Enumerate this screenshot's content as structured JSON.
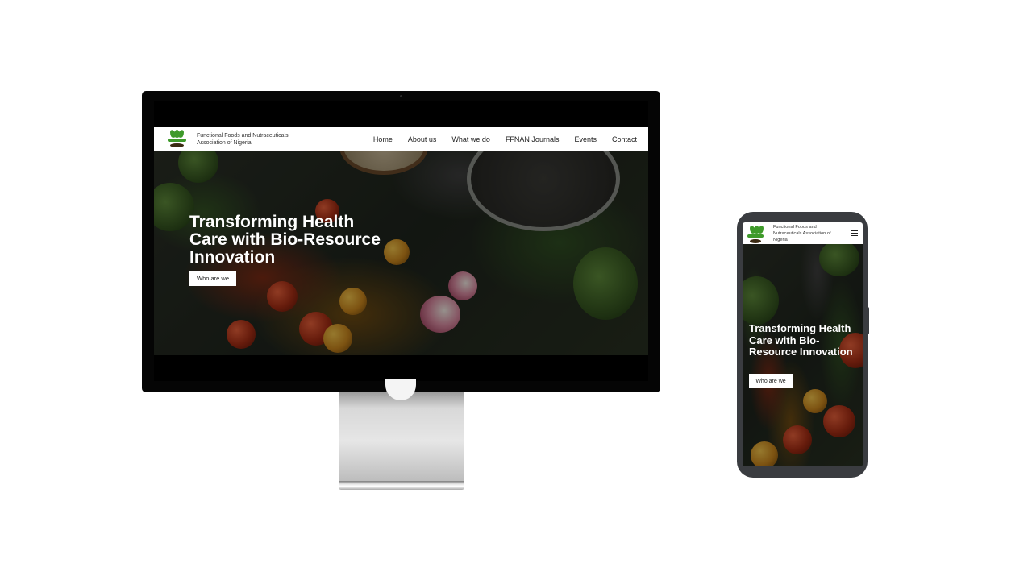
{
  "site": {
    "brand_name": "Functional Foods and Nutraceuticals Association of Nigeria",
    "nav_items": [
      "Home",
      "About us",
      "What we do",
      "FFNAN Journals",
      "Events",
      "Contact"
    ],
    "hero_title": "Transforming Health Care with Bio-Resource Innovation",
    "hero_button": "Who are we"
  },
  "mobile": {
    "brand_name": "Functional Foods and Nutraceuticals Association of Nigeria",
    "menu_icon": "hamburger-menu-icon",
    "hero_title": "Transforming Health Care with Bio-Resource Innovation",
    "hero_button": "Who are we"
  },
  "colors": {
    "nav_background": "#ffffff",
    "hero_text": "#ffffff",
    "device_frame": "#050505",
    "phone_frame": "#3a3c40"
  }
}
